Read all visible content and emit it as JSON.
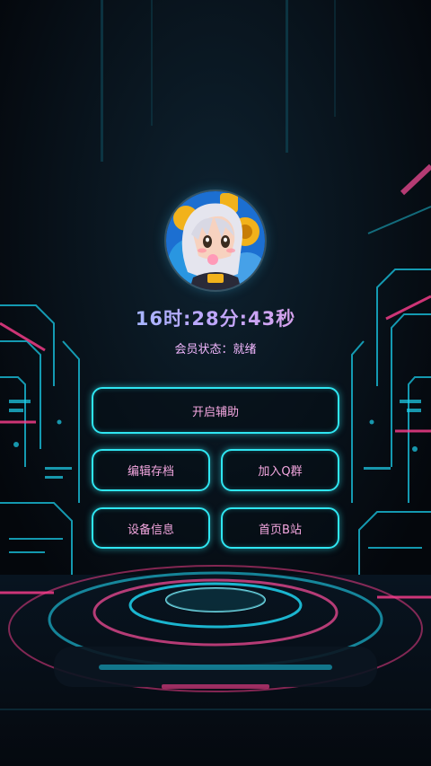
{
  "clock": {
    "text": "16时:28分:43秒"
  },
  "status": {
    "label": "会员状态：",
    "value": "就绪"
  },
  "buttons": {
    "start_assist": "开启辅助",
    "edit_save": "编辑存档",
    "join_qq": "加入Q群",
    "device_info": "设备信息",
    "home_bilibili": "首页B站"
  },
  "colors": {
    "button_border": "#2fe6f2",
    "button_text": "#f4a7e0",
    "clock_gradient_start": "#7fd7ff",
    "clock_gradient_end": "#ff9ad5",
    "status_text": "#e3a0e6",
    "background": "#05090f"
  },
  "icons": {
    "avatar": "anime-girl-with-headphones-avatar"
  }
}
